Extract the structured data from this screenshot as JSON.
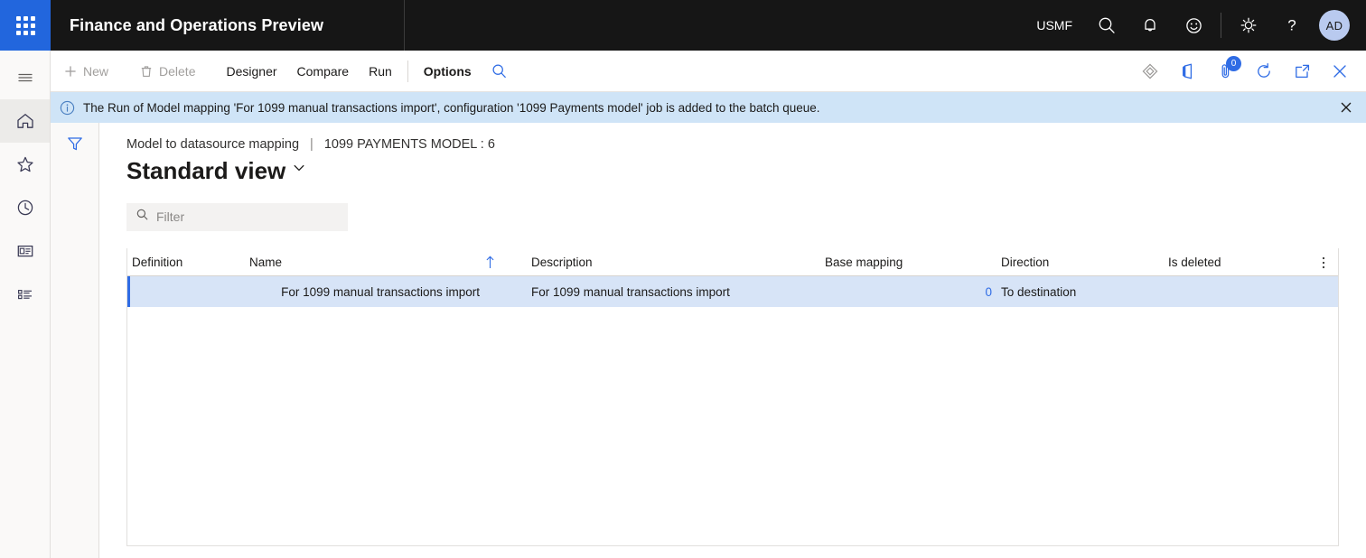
{
  "topnav": {
    "waffle_label": "app-launcher",
    "app_title": "Finance and Operations Preview",
    "company": "USMF",
    "icons": [
      "search-icon",
      "notifications-bell-icon",
      "feedback-smiley-icon",
      "settings-gear-icon",
      "help-question-icon"
    ],
    "avatar_initials": "AD"
  },
  "rail": {
    "items": [
      {
        "name": "hamburger-menu-icon",
        "label": "Expand the navigation pane"
      },
      {
        "name": "home-icon",
        "label": "Home",
        "active": true
      },
      {
        "name": "favorites-star-icon",
        "label": "Favorites"
      },
      {
        "name": "recent-clock-icon",
        "label": "Recent"
      },
      {
        "name": "workspaces-icon",
        "label": "Workspaces"
      },
      {
        "name": "modules-list-icon",
        "label": "Modules"
      }
    ]
  },
  "commandbar": {
    "buttons": [
      {
        "label": "New",
        "icon": "plus-icon",
        "disabled": true
      },
      {
        "label": "Delete",
        "icon": "trash-icon",
        "disabled": true
      },
      {
        "label": "Designer",
        "icon": "",
        "disabled": false
      },
      {
        "label": "Compare",
        "icon": "",
        "disabled": false
      },
      {
        "label": "Run",
        "icon": "",
        "disabled": false
      }
    ],
    "options_label": "Options",
    "search_icon": "search-icon",
    "right_icons": [
      {
        "name": "personalize-diamond-icon",
        "badge": ""
      },
      {
        "name": "open-in-office-icon",
        "badge": ""
      },
      {
        "name": "attachments-icon",
        "badge": "0"
      },
      {
        "name": "refresh-icon",
        "badge": ""
      },
      {
        "name": "popout-icon",
        "badge": ""
      },
      {
        "name": "close-icon",
        "badge": ""
      }
    ]
  },
  "messagebar": {
    "icon": "info-icon",
    "text": "The Run of Model mapping 'For 1099 manual transactions import', configuration '1099 Payments model' job is added to the batch queue.",
    "close_label": "Close"
  },
  "filterpane": {
    "funnel_icon": "filter-funnel-icon"
  },
  "content": {
    "breadcrumb": {
      "parent": "Model to datasource mapping",
      "separator": "|",
      "current": "1099 PAYMENTS MODEL : 6"
    },
    "page_title": "Standard view",
    "filter": {
      "placeholder": "Filter",
      "value": "",
      "icon": "search-icon"
    },
    "grid": {
      "columns": [
        {
          "key": "definition",
          "label": "Definition",
          "align": "left"
        },
        {
          "key": "name",
          "label": "Name",
          "align": "right",
          "sorted": "ascending"
        },
        {
          "key": "description",
          "label": "Description",
          "align": "left"
        },
        {
          "key": "base_mapping",
          "label": "Base mapping",
          "align": "right"
        },
        {
          "key": "direction",
          "label": "Direction",
          "align": "left"
        },
        {
          "key": "is_deleted",
          "label": "Is deleted",
          "align": "left"
        }
      ],
      "kebab_label": "Column options",
      "rows": [
        {
          "definition": "",
          "name": "For 1099 manual transactions import",
          "description": "For 1099 manual transactions import",
          "base_mapping": "0",
          "direction": "To destination",
          "is_deleted": "",
          "selected": true
        }
      ]
    }
  },
  "colors": {
    "nav_background": "#161616",
    "accent": "#2f6ce5",
    "waffle": "#2266dd",
    "message_background": "#cfe4f7",
    "row_selected": "#d7e4f7",
    "page_background": "#faf9f8"
  }
}
